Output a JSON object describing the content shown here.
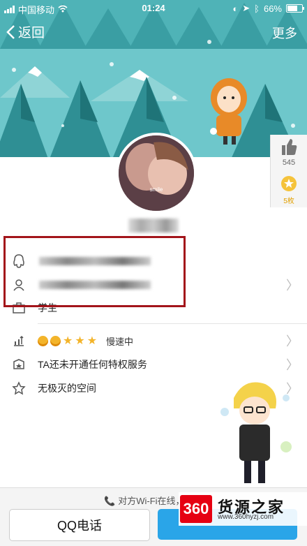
{
  "status_bar": {
    "carrier": "中国移动",
    "time": "01:24",
    "battery": "66%"
  },
  "nav": {
    "back_label": "返回",
    "more_label": "更多"
  },
  "avatar": {
    "text": "smile"
  },
  "likes": {
    "count": "545",
    "badge": "5枚"
  },
  "profile_rows": [
    {
      "icon": "person-icon",
      "label": "学生"
    },
    {
      "icon": "level-icon",
      "label": "慢速中"
    },
    {
      "icon": "privilege-icon",
      "label": "TA还未开通任何特权服务"
    },
    {
      "icon": "star-outline-icon",
      "label": "无极灭的空间"
    }
  ],
  "bottom": {
    "wifi_hint": "对方Wi-Fi在线，适合",
    "call_label": "QQ电话"
  },
  "watermark": {
    "logo": "360",
    "title": "货源之家",
    "url": "www.360hyzj.com"
  },
  "colors": {
    "accent": "#2aa5e8",
    "highlight": "#a3141a",
    "cover_sky": "#6ec7cb"
  }
}
